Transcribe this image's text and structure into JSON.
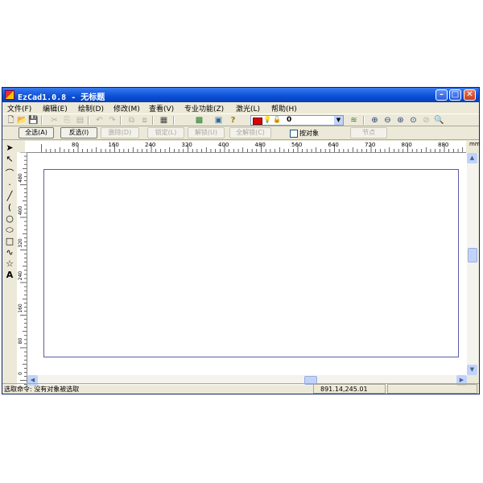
{
  "window": {
    "title": "EzCad1.0.8 - 无标题",
    "min": "–",
    "max": "□",
    "close": "✕"
  },
  "menu": [
    "文件(F)",
    "编辑(E)",
    "绘制(D)",
    "修改(M)",
    "查看(V)",
    "专业功能(Z)",
    "激光(L)",
    "帮助(H)"
  ],
  "toolbar": {
    "icons": [
      "new-icon",
      "open-icon",
      "save-icon",
      "cut-icon",
      "copy-icon",
      "paste-icon",
      "undo-icon",
      "redo-icon",
      "group-icon",
      "ungroup-icon",
      "bitmap-icon",
      "color-icon",
      "image-icon",
      "help-icon"
    ],
    "layer_value": "0",
    "layer_color": "#e00000",
    "zoom_icons": [
      "layers-icon",
      "zoom-in-icon",
      "zoom-out-icon",
      "zoom-all-icon",
      "zoom-window-icon",
      "zoom-prev-icon",
      "zoom-select-icon"
    ]
  },
  "selbar": {
    "select_all": "全选(A)",
    "invert": "反选(I)",
    "delete": "删除(D)",
    "lock": "锁定(L)",
    "unlock": "解锁(U)",
    "unlock_all": "全解锁(C)",
    "by_object": "按对象",
    "node": "节点"
  },
  "ruler": {
    "unit": "mm",
    "h_ticks": [
      "80",
      "160",
      "240",
      "320",
      "400",
      "480",
      "560",
      "640",
      "720",
      "800",
      "880"
    ],
    "v_ticks": [
      "480",
      "400",
      "320",
      "240",
      "160",
      "80",
      "0"
    ]
  },
  "status": {
    "command": "选取命令: 没有对象被选取",
    "coords": "891.14,245.01"
  },
  "colors": {
    "title_blue": "#0a4fd6",
    "page_border": "#5b5ba8"
  }
}
